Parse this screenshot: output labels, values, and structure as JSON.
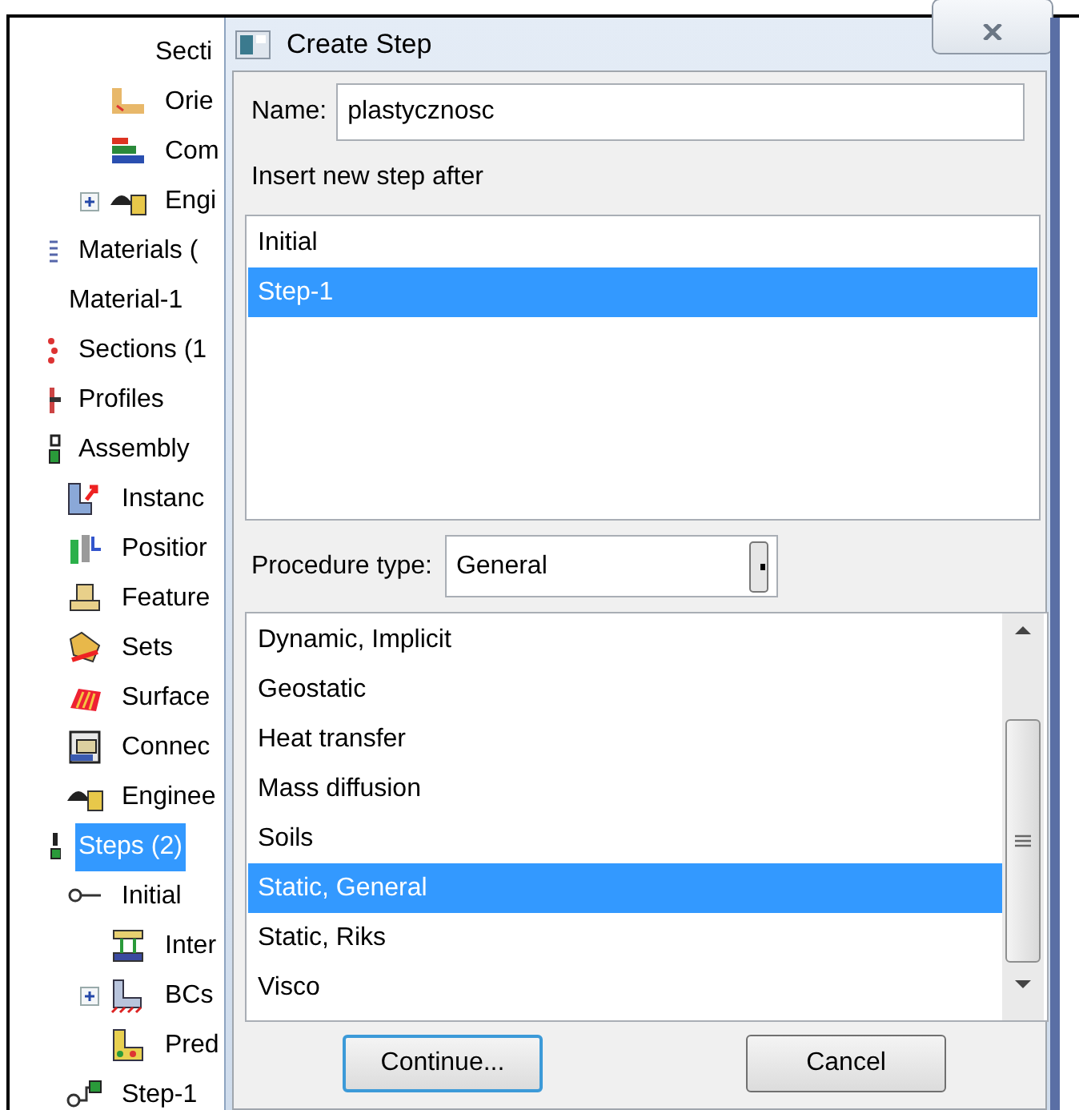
{
  "tree": {
    "items": [
      {
        "children": [
          {
            "children": [
              {
                "children": [
                  {
                    "label": "Secti"
                  }
                ]
              },
              {
                "label": "Orie",
                "kind": "orientation"
              },
              {
                "label": "Com",
                "kind": "composite"
              },
              {
                "label": "Engi",
                "kind": "engineering",
                "expanded": false
              }
            ]
          }
        ]
      },
      {
        "label": "Materials (",
        "kind": "materials",
        "children": [
          {
            "label": "Material-1"
          }
        ]
      },
      {
        "label": "Sections (1",
        "kind": "sections"
      },
      {
        "label": "Profiles",
        "kind": "profiles"
      },
      {
        "label": "Assembly",
        "kind": "assembly",
        "children": [
          {
            "label": "Instanc",
            "kind": "instance"
          },
          {
            "label": "Positior",
            "kind": "position"
          },
          {
            "label": "Feature",
            "kind": "feature"
          },
          {
            "label": "Sets",
            "kind": "sets"
          },
          {
            "label": "Surface",
            "kind": "surface"
          },
          {
            "label": "Connec",
            "kind": "connector"
          },
          {
            "label": "Enginee",
            "kind": "engineering"
          }
        ]
      },
      {
        "label": "Steps (2)",
        "kind": "steps",
        "selected": true,
        "children": [
          {
            "label": "Initial",
            "kind": "step-initial",
            "children": [
              {
                "label": "Inter",
                "kind": "interaction"
              },
              {
                "label": "BCs",
                "kind": "bc",
                "expanded": false
              },
              {
                "label": "Pred",
                "kind": "predefined"
              }
            ]
          },
          {
            "label": "Step-1",
            "kind": "step"
          }
        ]
      }
    ]
  },
  "dialog": {
    "title": "Create Step",
    "name_label": "Name:",
    "name_value": "plastycznosc",
    "insert_label": "Insert new step after",
    "steps": [
      {
        "label": "Initial",
        "selected": false
      },
      {
        "label": "Step-1",
        "selected": true
      }
    ],
    "procedure_label": "Procedure type:",
    "procedure_value": "General",
    "procedures": [
      {
        "label": "Dynamic, Implicit",
        "selected": false
      },
      {
        "label": "Geostatic",
        "selected": false
      },
      {
        "label": "Heat transfer",
        "selected": false
      },
      {
        "label": "Mass diffusion",
        "selected": false
      },
      {
        "label": "Soils",
        "selected": false
      },
      {
        "label": "Static, General",
        "selected": true
      },
      {
        "label": "Static, Riks",
        "selected": false
      },
      {
        "label": "Visco",
        "selected": false
      }
    ],
    "buttons": [
      {
        "label": "Continue...",
        "focused": true
      },
      {
        "label": "Cancel",
        "focused": false
      }
    ]
  }
}
